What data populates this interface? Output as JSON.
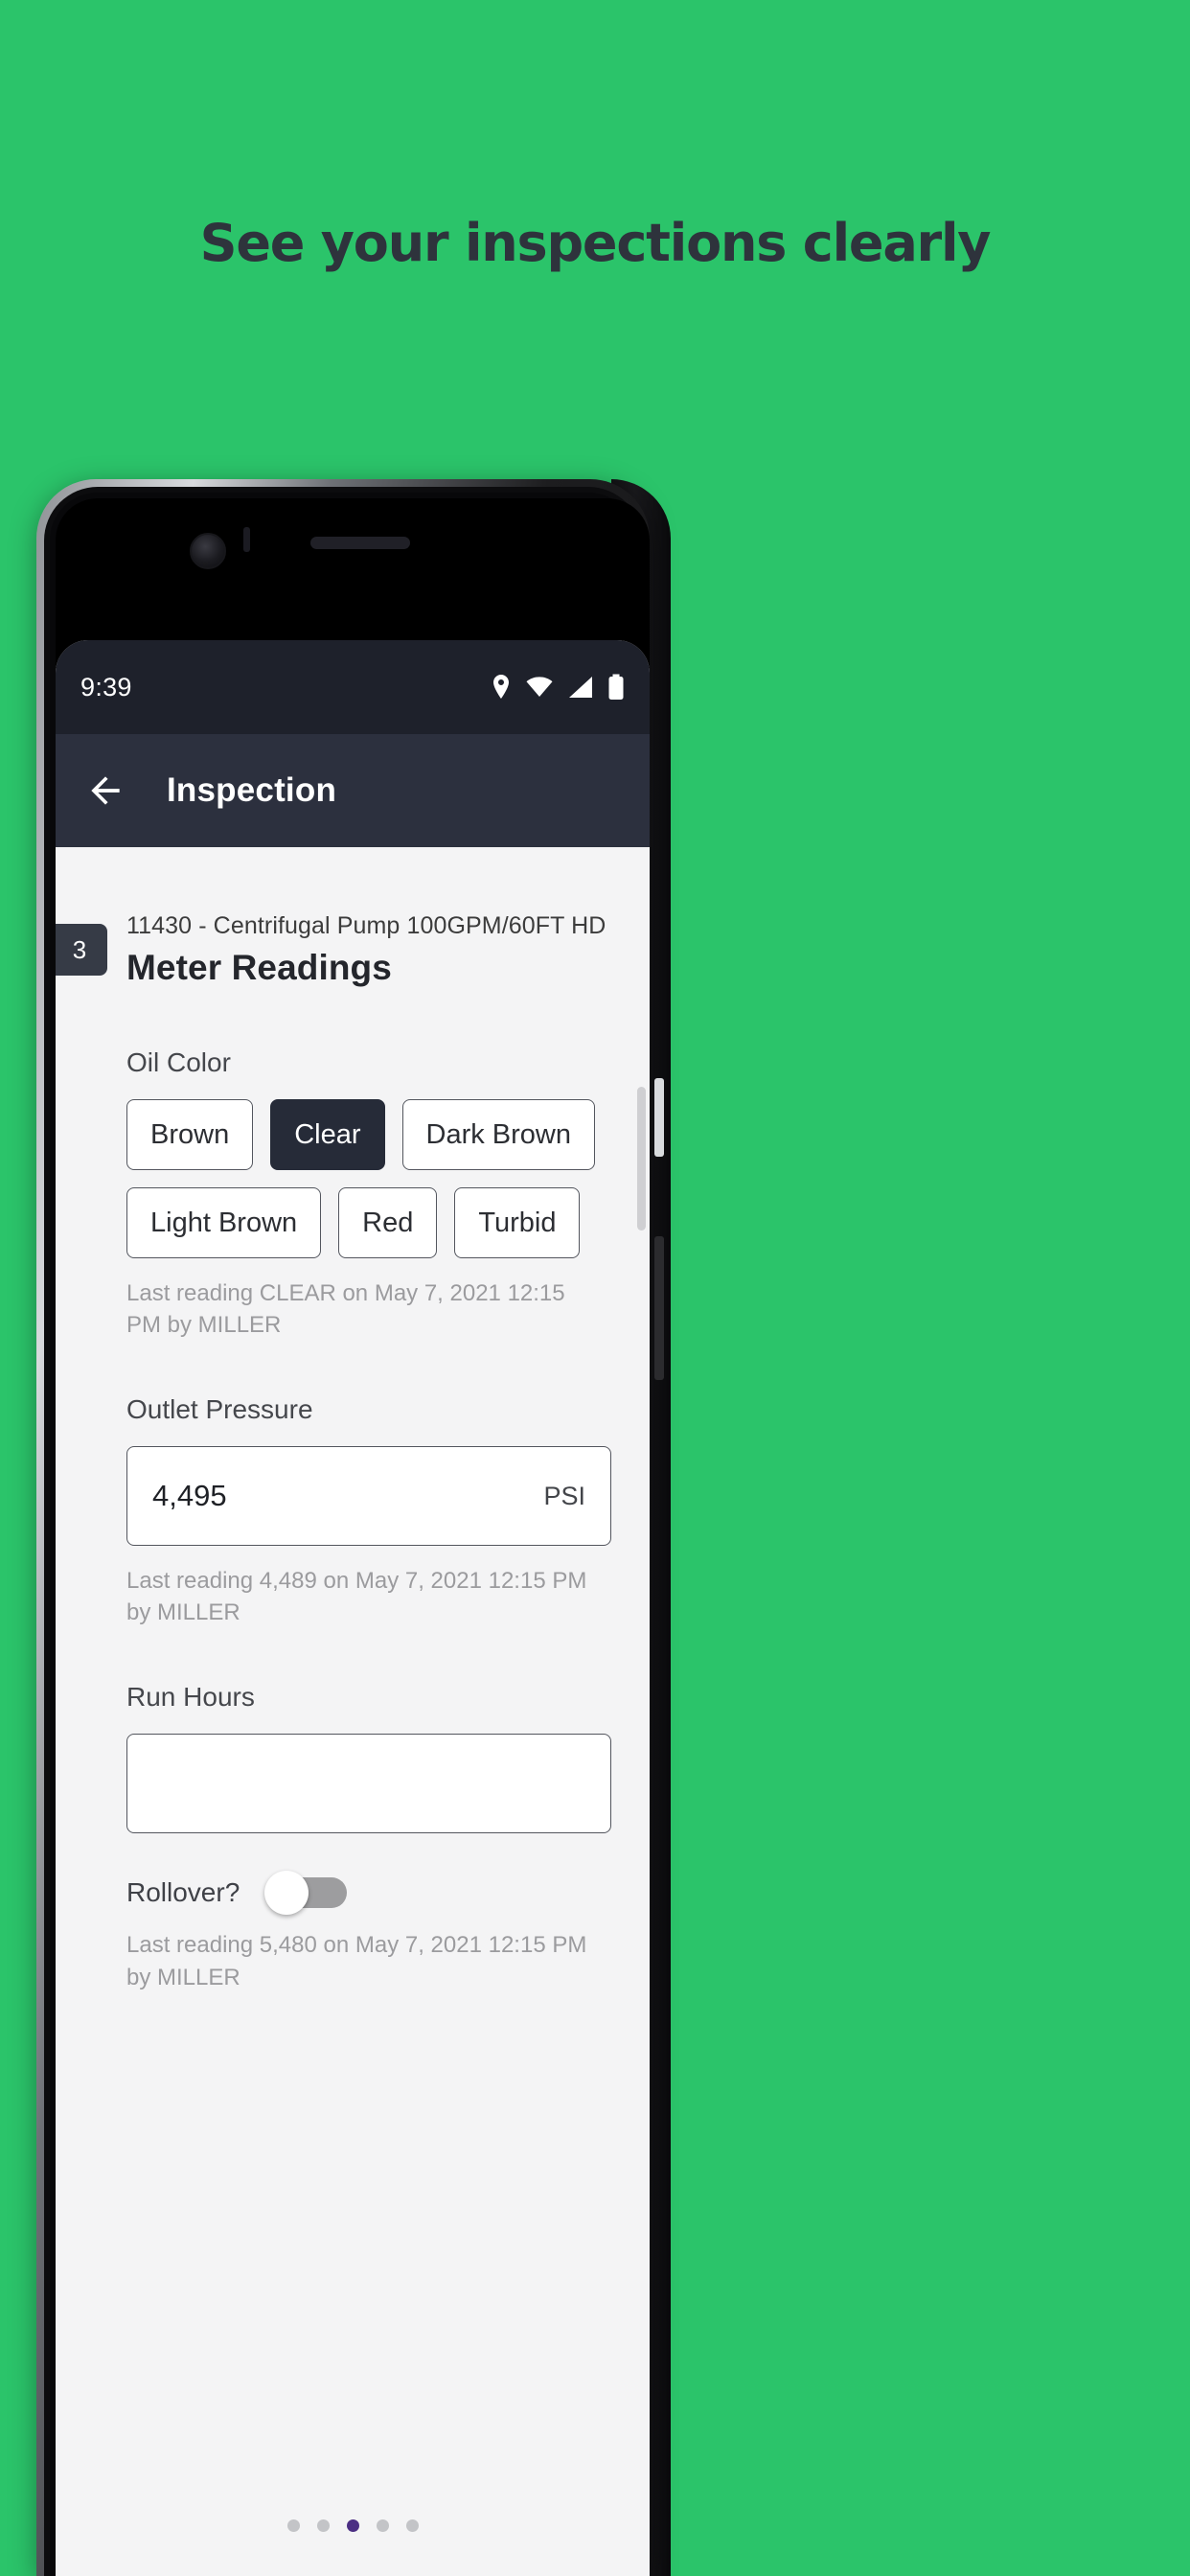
{
  "promo": {
    "headline": "See your inspections clearly",
    "background_color": "#2BC46A",
    "headline_color": "#2E333C"
  },
  "status_bar": {
    "time": "9:39",
    "icons": [
      "location-icon",
      "wifi-icon",
      "cellular-signal-icon",
      "battery-icon"
    ],
    "background_color": "#1E212B"
  },
  "app_bar": {
    "back_icon": "back-arrow-icon",
    "title": "Inspection",
    "background_color": "#2C303E"
  },
  "content": {
    "step_number": "3",
    "asset_line": "11430 - Centrifugal Pump 100GPM/60FT HD",
    "section_title": "Meter Readings",
    "fields": [
      {
        "key": "oil_color",
        "label": "Oil Color",
        "type": "chip-group",
        "options": [
          "Brown",
          "Clear",
          "Dark Brown",
          "Light Brown",
          "Red",
          "Turbid"
        ],
        "selected": "Clear",
        "helper": "Last reading CLEAR on May 7, 2021 12:15 PM by MILLER"
      },
      {
        "key": "outlet_pressure",
        "label": "Outlet Pressure",
        "type": "text-input",
        "value": "4,495",
        "placeholder": "",
        "suffix": "PSI",
        "helper": "Last reading 4,489 on May 7, 2021 12:15 PM by MILLER"
      },
      {
        "key": "run_hours",
        "label": "Run Hours",
        "type": "text-input",
        "value": "",
        "placeholder": "",
        "suffix": "",
        "toggle_label": "Rollover?",
        "toggle_state": "off",
        "helper": "Last reading 5,480 on May 7, 2021 12:15 PM by MILLER"
      }
    ]
  },
  "pager": {
    "total": 5,
    "active_index": 2,
    "active_color": "#4B2E83",
    "inactive_color": "#C3C4C7"
  }
}
